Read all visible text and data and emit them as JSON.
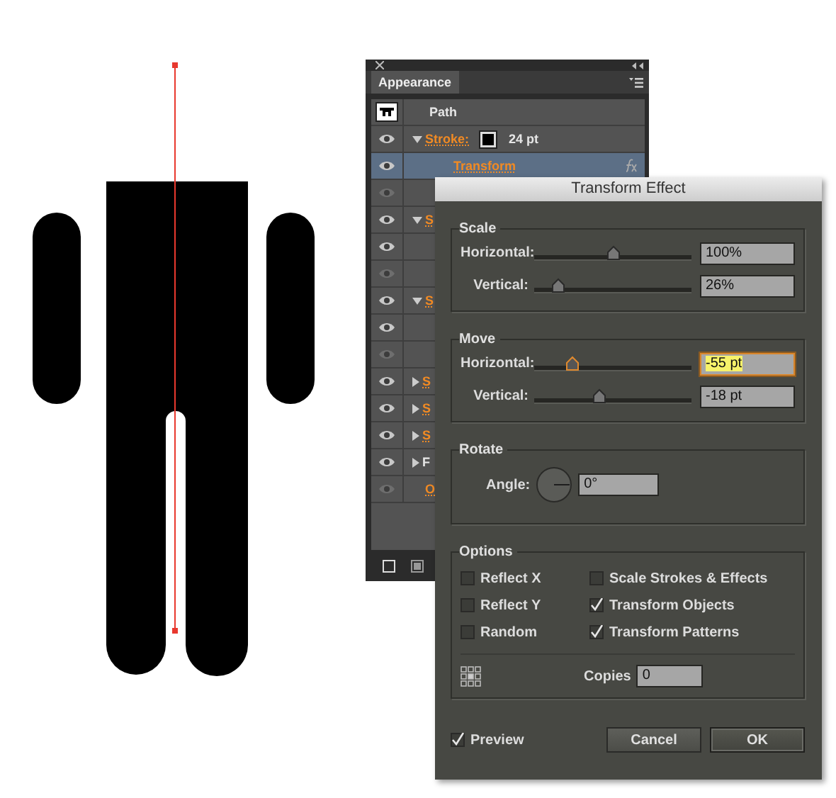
{
  "appearance_panel": {
    "tab": "Appearance",
    "rows": [
      {
        "kind": "object",
        "label": "Path",
        "selected": false
      },
      {
        "kind": "attribute",
        "eye_dimmed": false,
        "expanded": true,
        "linked": true,
        "label": "Stroke:",
        "value": "24 pt",
        "selected": false
      },
      {
        "kind": "effect",
        "eye_dimmed": false,
        "label": "Transform",
        "selected": true
      },
      {
        "kind": "blank",
        "eye_dimmed": true,
        "selected": false
      },
      {
        "kind": "attribute",
        "eye_dimmed": false,
        "expanded": true,
        "linked": true,
        "label": "S",
        "selected": false
      },
      {
        "kind": "blank",
        "eye_dimmed": false,
        "selected": false
      },
      {
        "kind": "blank",
        "eye_dimmed": true,
        "selected": false
      },
      {
        "kind": "attribute",
        "eye_dimmed": false,
        "expanded": true,
        "linked": true,
        "label": "S",
        "selected": false
      },
      {
        "kind": "blank",
        "eye_dimmed": false,
        "selected": false
      },
      {
        "kind": "blank",
        "eye_dimmed": true,
        "selected": false
      },
      {
        "kind": "attribute",
        "eye_dimmed": false,
        "expanded": false,
        "linked": true,
        "label": "S",
        "selected": false
      },
      {
        "kind": "attribute",
        "eye_dimmed": false,
        "expanded": false,
        "linked": true,
        "label": "S",
        "selected": false
      },
      {
        "kind": "attribute",
        "eye_dimmed": false,
        "expanded": false,
        "linked": true,
        "label": "S",
        "selected": false
      },
      {
        "kind": "attribute",
        "eye_dimmed": false,
        "expanded": false,
        "linked": false,
        "label": "F",
        "selected": false
      },
      {
        "kind": "attribute",
        "eye_dimmed": true,
        "linked": true,
        "label": "O",
        "selected": false
      }
    ]
  },
  "dialog": {
    "title": "Transform Effect",
    "sections": [
      {
        "kind": "sliders",
        "title": "Scale",
        "rows": [
          {
            "label": "Horizontal:",
            "level": 0.5,
            "value": "100%",
            "focused": false
          },
          {
            "label": "Vertical:",
            "level": 0.15,
            "value": "26%",
            "focused": false
          }
        ]
      },
      {
        "kind": "sliders",
        "title": "Move",
        "rows": [
          {
            "label": "Horizontal:",
            "level": 0.24,
            "value": "-55 pt",
            "focused": true
          },
          {
            "label": "Vertical:",
            "level": 0.41,
            "value": "-18 pt",
            "focused": false
          }
        ]
      },
      {
        "kind": "angle",
        "title": "Rotate",
        "label": "Angle:",
        "value": "0°"
      },
      {
        "kind": "options",
        "title": "Options",
        "checkboxes": [
          {
            "label": "Reflect X",
            "checked": false
          },
          {
            "label": "Scale Strokes & Effects",
            "checked": false
          },
          {
            "label": "Reflect Y",
            "checked": false
          },
          {
            "label": "Transform Objects",
            "checked": true
          },
          {
            "label": "Random",
            "checked": false
          },
          {
            "label": "Transform Patterns",
            "checked": true
          }
        ],
        "copies": {
          "label": "Copies",
          "value": "0"
        }
      }
    ],
    "preview": {
      "label": "Preview",
      "checked": true
    },
    "buttons": [
      {
        "label": "Cancel",
        "kind": "normal"
      },
      {
        "label": "OK",
        "kind": "default"
      }
    ]
  }
}
